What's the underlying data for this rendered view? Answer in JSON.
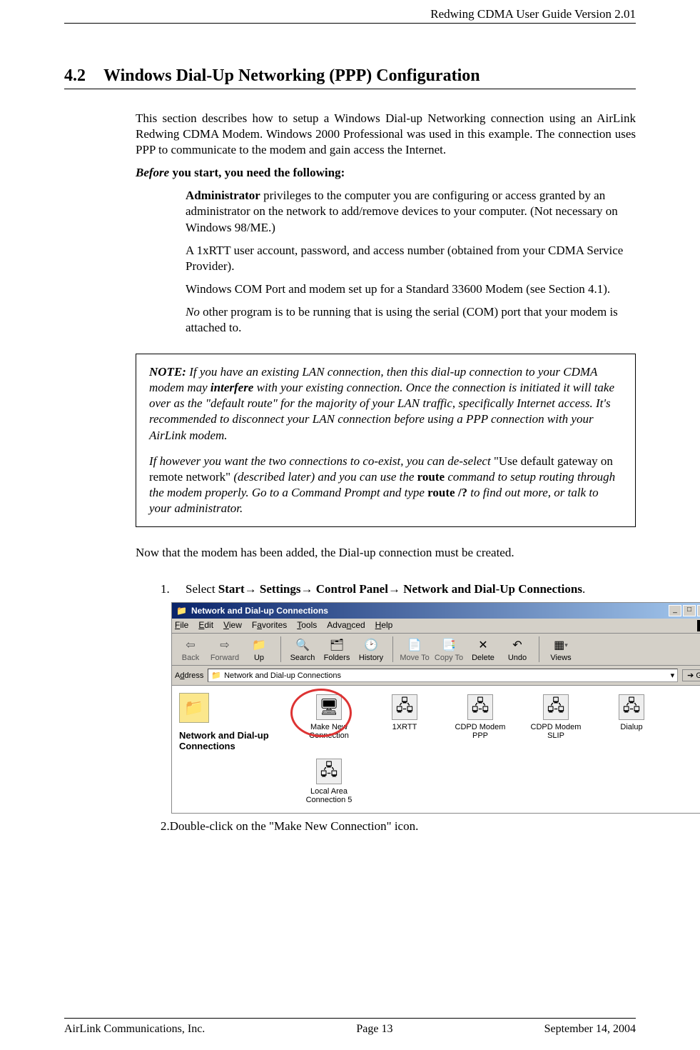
{
  "header": {
    "title": "Redwing CDMA User Guide Version 2.01"
  },
  "section": {
    "number": "4.2",
    "title": "Windows Dial-Up Networking (PPP) Configuration"
  },
  "intro": "This section describes how to setup a Windows Dial-up Networking connection using an AirLink Redwing CDMA Modem. Windows 2000 Professional was used in this example. The connection uses PPP to communicate to the modem and gain access the Internet.",
  "before_label_1": "Before",
  "before_label_2": " you start, you need the following:",
  "bullets": {
    "b1a": "Administrator",
    "b1b": " privileges to the computer you are configuring or access granted by an administrator on the network to add/remove devices to your computer. (Not necessary on Windows 98/ME.)",
    "b2": "A 1xRTT user account, password, and access number (obtained from your CDMA Service Provider).",
    "b3": "Windows COM Port and modem set up for a Standard 33600 Modem (see Section 4.1).",
    "b4a": "No",
    "b4b": " other program is to be running that is using the serial (COM) port that your modem is attached to."
  },
  "note": {
    "lead": "NOTE:",
    "p1": " If you have an existing LAN connection, then this dial-up connection to your CDMA modem may ",
    "interfere": "interfere",
    "p1b": " with your existing connection. Once the connection is initiated it will take over as the \"default route\" for the majority of your LAN traffic, specifically Internet access. It's recommended to disconnect your LAN connection before using a PPP connection with your AirLink modem.",
    "p2a": "If however you want the two connections to co-exist, you can de-select ",
    "p2_upright": "\"Use default gateway on remote network\"",
    "p2b": " (described later) and you can use the ",
    "route": "route",
    "p2c": " command to setup routing through the modem properly. Go to a Command Prompt and type ",
    "route2": "route /?",
    "p2d": " to find out more, or talk to your administrator."
  },
  "now": "Now that the modem has been added, the Dial-up connection must be created.",
  "step1": {
    "num": "1.",
    "pre": "Select ",
    "bold": "Start→ Settings→ Control Panel→ Network and Dial-Up Connections",
    "post": "."
  },
  "step2": {
    "num": "2.",
    "text": "Double-click on the \"Make New Connection\" icon."
  },
  "win": {
    "title": "Network and Dial-up Connections",
    "menu": {
      "file": "File",
      "edit": "Edit",
      "view": "View",
      "fav": "Favorites",
      "tools": "Tools",
      "adv": "Advanced",
      "help": "Help"
    },
    "toolbar": {
      "back": "Back",
      "forward": "Forward",
      "up": "Up",
      "search": "Search",
      "folders": "Folders",
      "history": "History",
      "moveto": "Move To",
      "copyto": "Copy To",
      "delete": "Delete",
      "undo": "Undo",
      "views": "Views"
    },
    "addr_label": "Address",
    "addr_value": "Network and Dial-up Connections",
    "go": "Go",
    "side_title": "Network and Dial-up Connections",
    "icons": {
      "make": "Make New Connection",
      "xrtt": "1XRTT",
      "ppp": "CDPD Modem PPP",
      "slip": "CDPD Modem SLIP",
      "dial": "Dialup",
      "lan": "Local Area Connection 5"
    }
  },
  "footer": {
    "left": "AirLink Communications, Inc.",
    "center": "Page 13",
    "right": "September 14, 2004"
  }
}
